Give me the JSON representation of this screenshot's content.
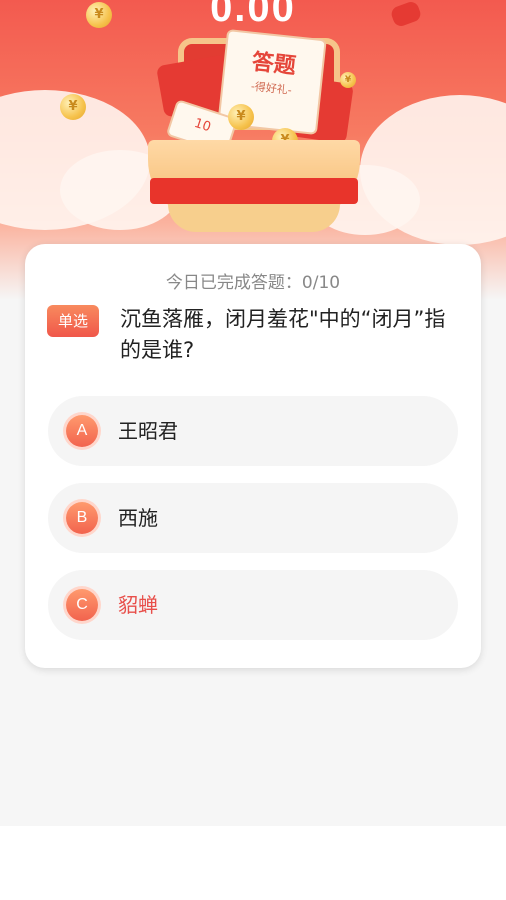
{
  "header": {
    "amount": "0.00",
    "banner_title": "答题",
    "banner_subtitle": "-得好礼-",
    "coin_label": "¥",
    "ticket_value": "10"
  },
  "quiz": {
    "progress_text": "今日已完成答题：0/10",
    "type_badge": "单选",
    "question": "沉鱼落雁，闭月羞花\"中的“闭月”指的是谁?",
    "options": [
      {
        "letter": "A",
        "text": "王昭君"
      },
      {
        "letter": "B",
        "text": "西施"
      },
      {
        "letter": "C",
        "text": "貂蝉"
      }
    ]
  },
  "colors": {
    "accent": "#f2634e",
    "hero_red": "#f35a4f",
    "highlight_text": "#e84f4a"
  }
}
